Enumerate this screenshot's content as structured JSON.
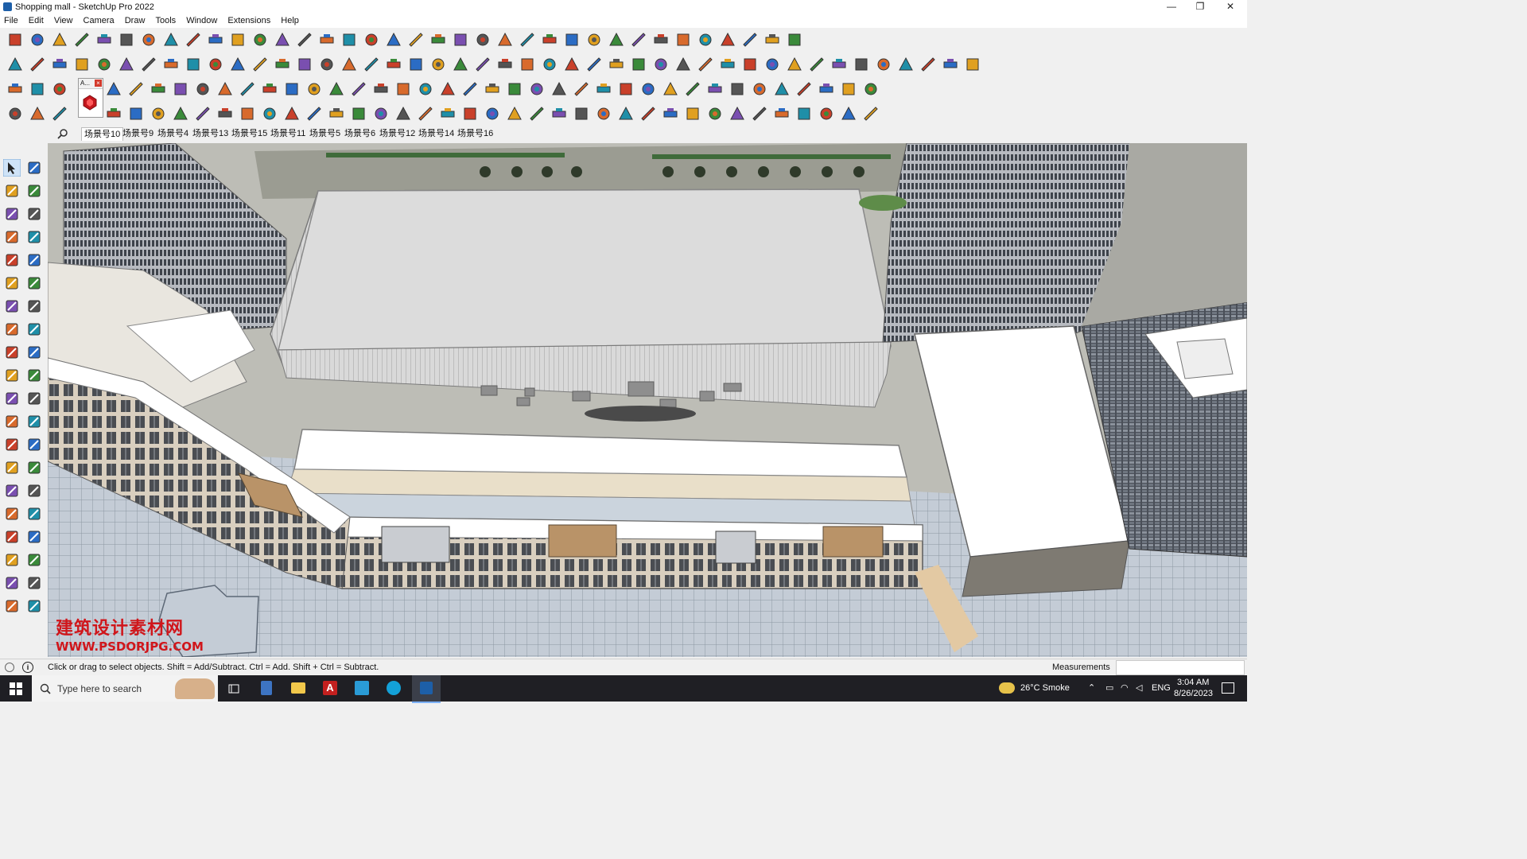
{
  "window": {
    "title": "Shopping mall - SketchUp Pro 2022",
    "minimize": "—",
    "maximize": "❐",
    "close": "✕"
  },
  "menu": [
    "File",
    "Edit",
    "View",
    "Camera",
    "Draw",
    "Tools",
    "Window",
    "Extensions",
    "Help"
  ],
  "scenes": [
    "场景号10",
    "场景号9",
    "场景号4",
    "场景号13",
    "场景号15",
    "场景号11",
    "场景号5",
    "场景号6",
    "场景号12",
    "场景号14",
    "场景号16"
  ],
  "active_scene": "场景号10",
  "floating_toolbar": {
    "title": "A..."
  },
  "status": {
    "message": "Click or drag to select objects. Shift = Add/Subtract. Ctrl = Add. Shift + Ctrl = Subtract.",
    "measurements_label": "Measurements",
    "measurements_value": ""
  },
  "watermark": {
    "cn": "建筑设计素材网",
    "url": "WWW.PSDORJPG.COM"
  },
  "taskbar": {
    "search_placeholder": "Type here to search",
    "weather": "26°C  Smoke",
    "lang": "ENG",
    "time": "3:04 AM",
    "date": "8/26/2023"
  },
  "colors": {
    "accent": "#1d5fa8",
    "red": "#d33a2c",
    "taskbar": "#1f1f24"
  }
}
